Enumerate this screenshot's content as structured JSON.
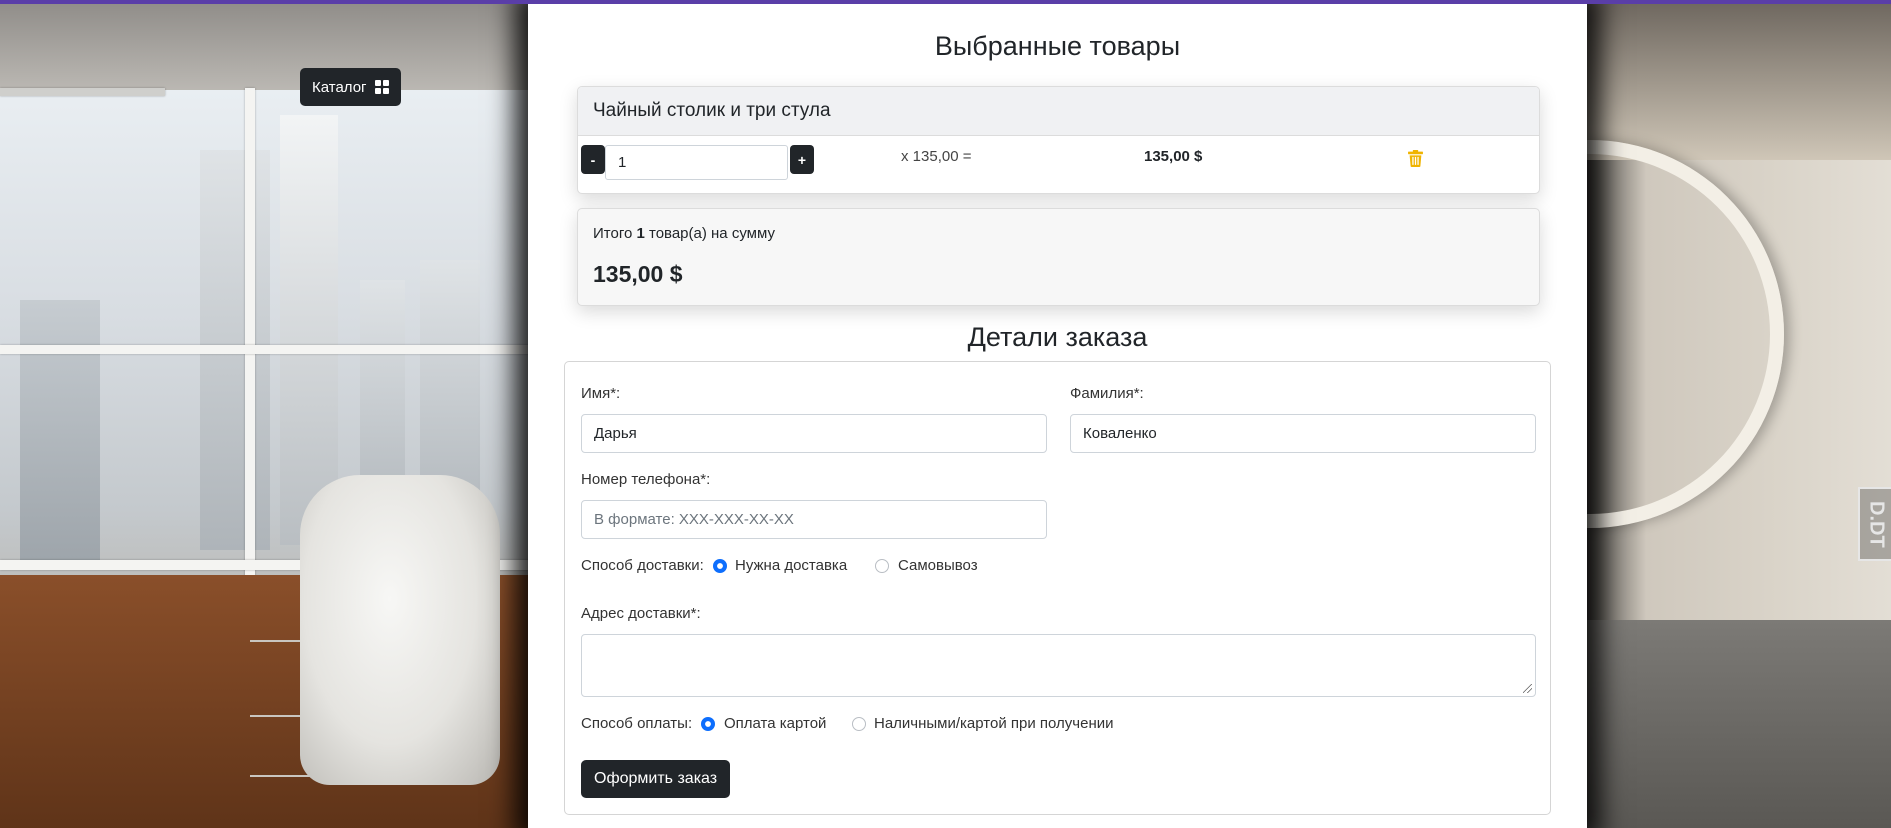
{
  "nav": {
    "catalog_label": "Каталог"
  },
  "cart": {
    "title": "Выбранные товары",
    "items": [
      {
        "name": "Чайный столик и три стула",
        "minus_label": "-",
        "plus_label": "+",
        "quantity": "1",
        "unit_price": "x 135,00 =",
        "line_total": "135,00 $"
      }
    ],
    "summary": {
      "prefix": "Итого ",
      "count": "1",
      "suffix": " товар(а) на сумму",
      "total": "135,00 $"
    }
  },
  "order": {
    "title": "Детали заказа",
    "first_name": {
      "label": "Имя*:",
      "value": "Дарья"
    },
    "last_name": {
      "label": "Фамилия*:",
      "value": "Коваленко"
    },
    "phone": {
      "label": "Номер телефона*:",
      "placeholder": "В формате: XXX-XXX-XX-XX"
    },
    "delivery": {
      "label": "Способ доставки:",
      "options": [
        {
          "label": "Нужна доставка",
          "selected": true
        },
        {
          "label": "Самовывоз",
          "selected": false
        }
      ]
    },
    "address": {
      "label": "Адрес доставки*:",
      "value": ""
    },
    "payment": {
      "label": "Способ оплаты:",
      "options": [
        {
          "label": "Оплата картой",
          "selected": true
        },
        {
          "label": "Наличными/картой при получении",
          "selected": false
        }
      ]
    },
    "submit_label": "Оформить заказ"
  },
  "colors": {
    "accent": "#0d6efd",
    "dark": "#212529",
    "trash": "#f0b400",
    "top_bar": "#5a3ea8"
  },
  "icons": {
    "catalog": "grid-icon",
    "remove": "trash-icon"
  }
}
